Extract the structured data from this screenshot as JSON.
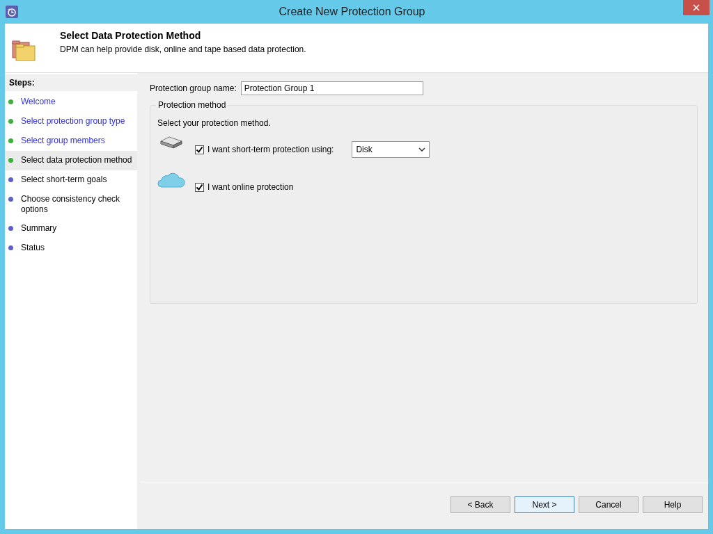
{
  "window": {
    "title": "Create New Protection Group"
  },
  "header": {
    "title": "Select Data Protection Method",
    "description": "DPM can help provide disk, online and tape based data protection."
  },
  "steps": {
    "heading": "Steps:",
    "items": [
      {
        "label": "Welcome",
        "completed": true,
        "selected": false
      },
      {
        "label": "Select protection group type",
        "completed": true,
        "selected": false
      },
      {
        "label": "Select group members",
        "completed": true,
        "selected": false
      },
      {
        "label": "Select data protection method",
        "completed": true,
        "selected": true
      },
      {
        "label": "Select short-term goals",
        "completed": false,
        "selected": false
      },
      {
        "label": "Choose consistency check options",
        "completed": false,
        "selected": false
      },
      {
        "label": "Summary",
        "completed": false,
        "selected": false
      },
      {
        "label": "Status",
        "completed": false,
        "selected": false
      }
    ]
  },
  "group_name": {
    "label": "Protection group name:",
    "value": "Protection Group 1"
  },
  "protection_method": {
    "legend": "Protection method",
    "instruction": "Select your protection method.",
    "options": [
      {
        "kind": "disk",
        "label": "I want short-term protection using:",
        "checked": true,
        "dropdown": "Disk"
      },
      {
        "kind": "online",
        "label": "I want online protection",
        "checked": true
      }
    ]
  },
  "buttons": [
    {
      "label": "< Back",
      "default": false
    },
    {
      "label": "Next >",
      "default": true
    },
    {
      "label": "Cancel",
      "default": false
    },
    {
      "label": "Help",
      "default": false
    }
  ]
}
